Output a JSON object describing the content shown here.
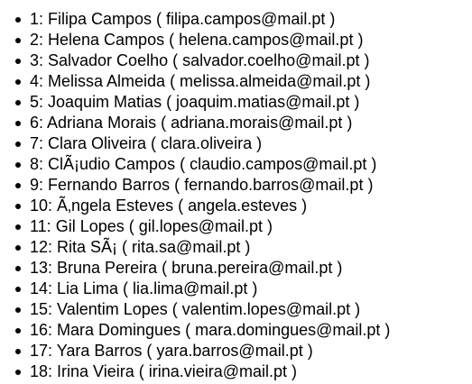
{
  "users": [
    {
      "label": "1: Filipa Campos ( filipa.campos@mail.pt )"
    },
    {
      "label": "2: Helena Campos ( helena.campos@mail.pt )"
    },
    {
      "label": "3: Salvador Coelho ( salvador.coelho@mail.pt )"
    },
    {
      "label": "4: Melissa Almeida ( melissa.almeida@mail.pt )"
    },
    {
      "label": "5: Joaquim Matias ( joaquim.matias@mail.pt )"
    },
    {
      "label": "6: Adriana Morais ( adriana.morais@mail.pt )"
    },
    {
      "label": "7: Clara Oliveira ( clara.oliveira )"
    },
    {
      "label": "8: ClÃ¡udio Campos ( claudio.campos@mail.pt )"
    },
    {
      "label": "9: Fernando Barros ( fernando.barros@mail.pt )"
    },
    {
      "label": "10: Ã‚ngela Esteves ( angela.esteves )"
    },
    {
      "label": "11: Gil Lopes ( gil.lopes@mail.pt )"
    },
    {
      "label": "12: Rita SÃ¡ ( rita.sa@mail.pt )"
    },
    {
      "label": "13: Bruna Pereira ( bruna.pereira@mail.pt )"
    },
    {
      "label": "14: Lia Lima ( lia.lima@mail.pt )"
    },
    {
      "label": "15: Valentim Lopes ( valentim.lopes@mail.pt )"
    },
    {
      "label": "16: Mara Domingues ( mara.domingues@mail.pt )"
    },
    {
      "label": "17: Yara Barros ( yara.barros@mail.pt )"
    },
    {
      "label": "18: Irina Vieira ( irina.vieira@mail.pt )"
    }
  ]
}
